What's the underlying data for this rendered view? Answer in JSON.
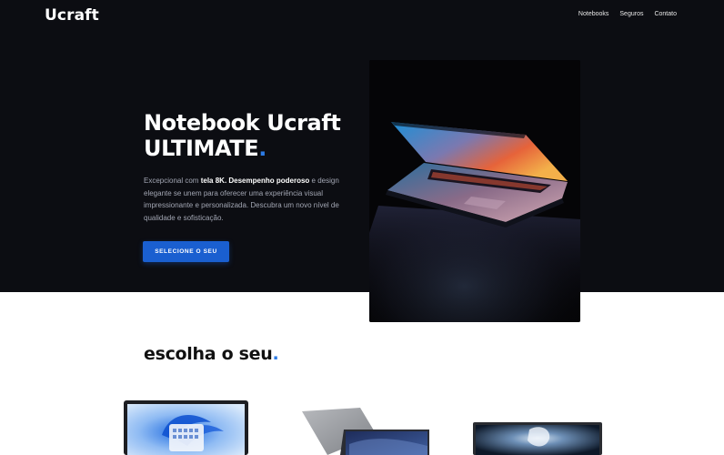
{
  "header": {
    "brand": "Ucraft",
    "nav": [
      "Notebooks",
      "Seguros",
      "Contato"
    ]
  },
  "hero": {
    "title_line1": "Notebook Ucraft",
    "title_line2": "ULTIMATE",
    "title_dot": ".",
    "desc": {
      "part1": "Excepcional com ",
      "bold1": "tela 8K. Desempenho poderoso",
      "part2": " e design elegante se unem para oferecer uma experiência visual impressionante e personalizada. Descubra um novo nível de qualidade e sofisticação."
    },
    "cta_label": "SELECIONE O SEU",
    "image": "laptop-photo"
  },
  "section": {
    "title": "escolha o seu",
    "title_dot": "."
  },
  "products": [
    {
      "image": "laptop-windows-11"
    },
    {
      "image": "laptop-gray-angled"
    },
    {
      "image": "laptop-dark-display"
    }
  ],
  "colors": {
    "hero_bg": "#0c0d12",
    "accent": "#2c7be5",
    "button": "#1a5fd0"
  }
}
